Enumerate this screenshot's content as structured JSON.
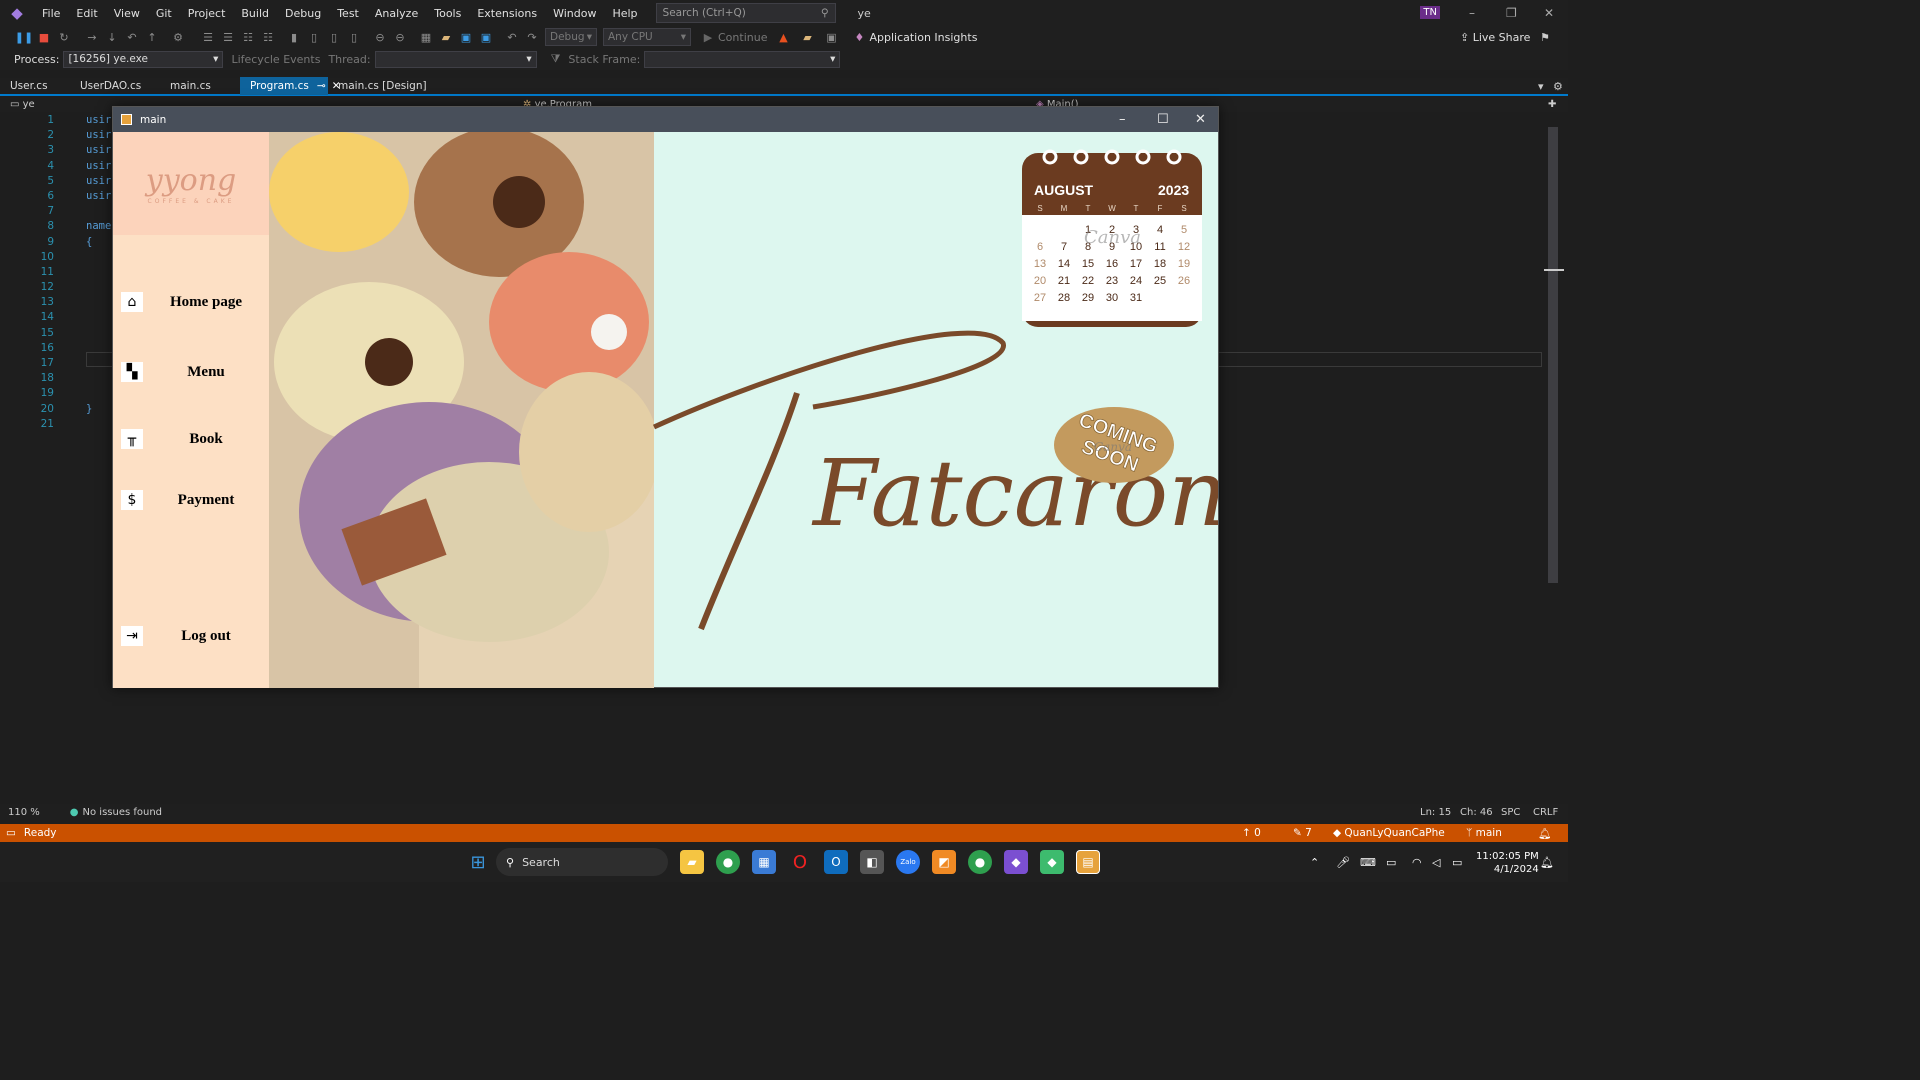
{
  "menubar": {
    "items": [
      "File",
      "Edit",
      "View",
      "Git",
      "Project",
      "Build",
      "Debug",
      "Test",
      "Analyze",
      "Tools",
      "Extensions",
      "Window",
      "Help"
    ],
    "search_placeholder": "Search (Ctrl+Q)",
    "solution": "ye",
    "user_initials": "TN"
  },
  "toolbar": {
    "config": "Debug",
    "platform": "Any CPU",
    "continue": "Continue",
    "app_insights": "Application Insights",
    "live_share": "Live Share"
  },
  "debugbar": {
    "process_label": "Process:",
    "process_value": "[16256] ye.exe",
    "lifecycle": "Lifecycle Events",
    "thread_label": "Thread:",
    "stack_label": "Stack Frame:"
  },
  "tabs": [
    "User.cs",
    "UserDAO.cs",
    "main.cs",
    "Program.cs",
    "main.cs [Design]"
  ],
  "active_tab": "Program.cs",
  "navbar": {
    "project": "ye",
    "class": "ye.Program",
    "member": "Main()"
  },
  "line_numbers": [
    "1",
    "2",
    "3",
    "4",
    "5",
    "6",
    "7",
    "8",
    "9",
    "10",
    "11",
    "12",
    "13",
    "14",
    "15",
    "16",
    "17",
    "18",
    "19",
    "20",
    "21"
  ],
  "code_lines": [
    "usir",
    "usir",
    "usir",
    "usir",
    "usir",
    "usir",
    "",
    "name",
    "{",
    "",
    "",
    "",
    "",
    "",
    "",
    "",
    "",
    "",
    "",
    "}",
    ""
  ],
  "editor_status": {
    "zoom": "110 %",
    "issues": "No issues found",
    "ln": "Ln: 15",
    "ch": "Ch: 46",
    "spc": "SPC",
    "crlf": "CRLF"
  },
  "statusbar": {
    "ready": "Ready",
    "up": "0",
    "pencil": "7",
    "repo": "QuanLyQuanCaPhe",
    "branch": "main"
  },
  "taskbar": {
    "search": "Search",
    "time": "11:02:05 PM",
    "date": "4/1/2024"
  },
  "form": {
    "title": "main",
    "brand": {
      "name": "yyong",
      "sub": "COFFEE & CAKE"
    },
    "nav": [
      {
        "label": "Home page",
        "icon": "home-icon"
      },
      {
        "label": "Menu",
        "icon": "grid-icon"
      },
      {
        "label": "Book",
        "icon": "table-icon"
      },
      {
        "label": "Payment",
        "icon": "dollar-icon"
      },
      {
        "label": "Log out",
        "icon": "logout-icon"
      }
    ],
    "script_text": "Fatcaron",
    "calendar": {
      "month": "AUGUST",
      "year": "2023",
      "days_header": [
        "S",
        "M",
        "T",
        "W",
        "T",
        "F",
        "S"
      ],
      "days": [
        "",
        "",
        "1",
        "2",
        "3",
        "4",
        "5",
        "6",
        "7",
        "8",
        "9",
        "10",
        "11",
        "12",
        "13",
        "14",
        "15",
        "16",
        "17",
        "18",
        "19",
        "20",
        "21",
        "22",
        "23",
        "24",
        "25",
        "26",
        "27",
        "28",
        "29",
        "30",
        "31",
        "",
        ""
      ],
      "watermark": "Canva"
    },
    "coming_soon": {
      "line1": "COMING",
      "line2": "SOON",
      "watermark": "Canva"
    }
  },
  "colors": {
    "accent": "#007acc",
    "status": "#ca5100",
    "sidebar": "#fde0c5",
    "brand_bg": "#fcd3bb",
    "content_bg": "#ddf7ef",
    "script": "#7a4a2a",
    "cal": "#7a4a2a"
  }
}
